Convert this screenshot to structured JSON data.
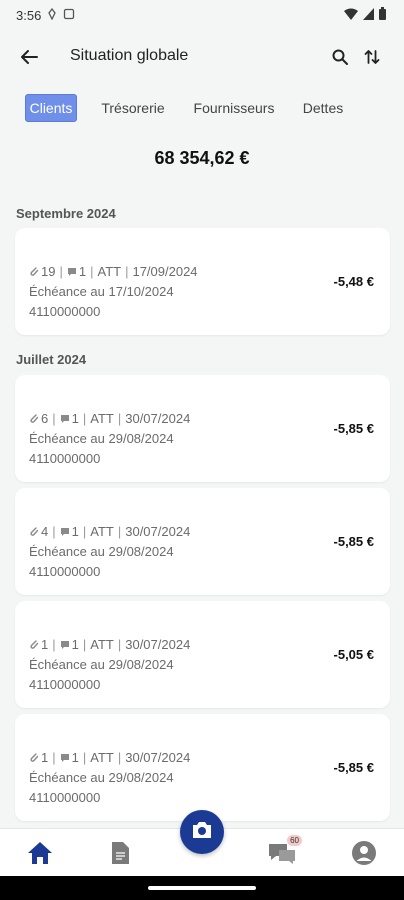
{
  "status": {
    "time": "3:56"
  },
  "header": {
    "title": "Situation globale"
  },
  "tabs": [
    {
      "label": "Clients",
      "active": true
    },
    {
      "label": "Trésorerie",
      "active": false
    },
    {
      "label": "Fournisseurs",
      "active": false
    },
    {
      "label": "Dettes",
      "active": false
    }
  ],
  "total": "68 354,62 €",
  "sections": [
    {
      "title": "Septembre 2024"
    },
    {
      "title": "Juillet 2024"
    }
  ],
  "cards": [
    {
      "attachments": "19",
      "comments": "1",
      "status": "ATT",
      "date": "17/09/2024",
      "due": "Échéance au 17/10/2024",
      "account": "4110000000",
      "amount": "-5,48 €"
    },
    {
      "attachments": "6",
      "comments": "1",
      "status": "ATT",
      "date": "30/07/2024",
      "due": "Échéance au 29/08/2024",
      "account": "4110000000",
      "amount": "-5,85 €"
    },
    {
      "attachments": "4",
      "comments": "1",
      "status": "ATT",
      "date": "30/07/2024",
      "due": "Échéance au 29/08/2024",
      "account": "4110000000",
      "amount": "-5,85 €"
    },
    {
      "attachments": "1",
      "comments": "1",
      "status": "ATT",
      "date": "30/07/2024",
      "due": "Échéance au 29/08/2024",
      "account": "4110000000",
      "amount": "-5,05 €"
    },
    {
      "attachments": "1",
      "comments": "1",
      "status": "ATT",
      "date": "30/07/2024",
      "due": "Échéance au 29/08/2024",
      "account": "4110000000",
      "amount": "-5,85 €"
    }
  ],
  "bottom_nav": {
    "messages_badge": "60",
    "icons": [
      "home-icon",
      "document-icon",
      "camera-icon",
      "chat-icon",
      "profile-icon"
    ]
  },
  "colors": {
    "primary": "#1b3a94",
    "tab_active": "#6f8fe8",
    "background": "#f4f6f6"
  }
}
